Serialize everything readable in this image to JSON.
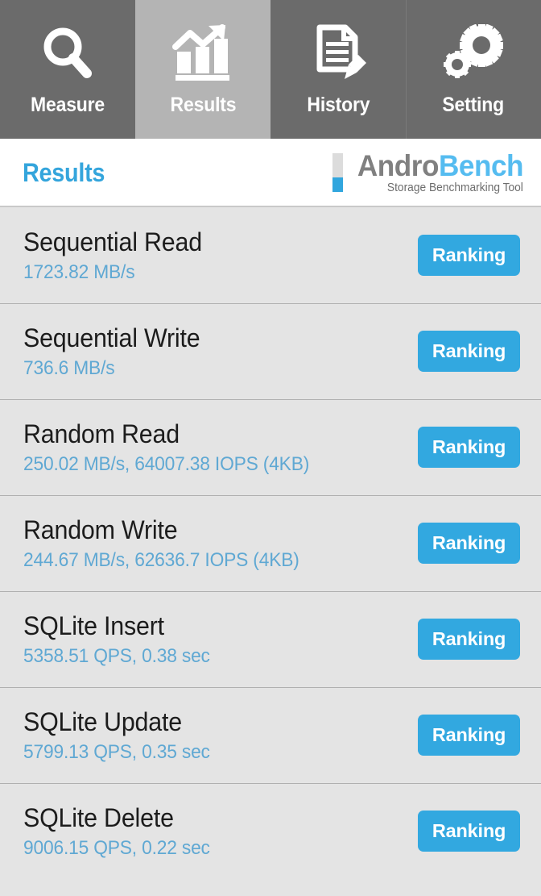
{
  "tabs": [
    {
      "id": "measure",
      "label": "Measure",
      "icon": "magnifier-icon",
      "active": false
    },
    {
      "id": "results",
      "label": "Results",
      "icon": "bar-chart-arrow-icon",
      "active": true
    },
    {
      "id": "history",
      "label": "History",
      "icon": "document-pencil-icon",
      "active": false
    },
    {
      "id": "setting",
      "label": "Setting",
      "icon": "gears-icon",
      "active": false
    }
  ],
  "header": {
    "title": "Results",
    "logo": {
      "word_primary": "Andro",
      "word_secondary": "Bench",
      "tagline": "Storage Benchmarking Tool"
    }
  },
  "results": [
    {
      "name": "Sequential Read",
      "value": "1723.82 MB/s",
      "action": "Ranking"
    },
    {
      "name": "Sequential Write",
      "value": "736.6 MB/s",
      "action": "Ranking"
    },
    {
      "name": "Random Read",
      "value": "250.02 MB/s, 64007.38 IOPS (4KB)",
      "action": "Ranking"
    },
    {
      "name": "Random Write",
      "value": "244.67 MB/s, 62636.7 IOPS (4KB)",
      "action": "Ranking"
    },
    {
      "name": "SQLite Insert",
      "value": "5358.51 QPS, 0.38 sec",
      "action": "Ranking"
    },
    {
      "name": "SQLite Update",
      "value": "5799.13 QPS, 0.35 sec",
      "action": "Ranking"
    },
    {
      "name": "SQLite Delete",
      "value": "9006.15 QPS, 0.22 sec",
      "action": "Ranking"
    }
  ],
  "colors": {
    "accent_blue": "#32a8e0",
    "value_blue": "#5fa8d3",
    "logo_gray": "#808080",
    "logo_blue": "#55bcf0",
    "tab_inactive": "#6b6b6b",
    "tab_active": "#b4b4b4",
    "list_background": "#e4e4e4"
  }
}
